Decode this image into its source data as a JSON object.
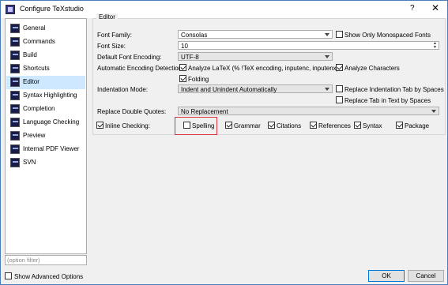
{
  "window": {
    "title": "Configure TeXstudio",
    "help": "?",
    "close": "✕"
  },
  "sidebar": {
    "items": [
      {
        "label": "General"
      },
      {
        "label": "Commands"
      },
      {
        "label": "Build"
      },
      {
        "label": "Shortcuts"
      },
      {
        "label": "Editor"
      },
      {
        "label": "Syntax Highlighting"
      },
      {
        "label": "Completion"
      },
      {
        "label": "Language Checking"
      },
      {
        "label": "Preview"
      },
      {
        "label": "Internal PDF Viewer"
      },
      {
        "label": "SVN"
      }
    ],
    "selected": "Editor",
    "filter_placeholder": "(option filter)"
  },
  "editor": {
    "group_title": "Editor",
    "font_family_label": "Font Family:",
    "font_family_value": "Consolas",
    "show_monospaced_label": "Show Only Monospaced Fonts",
    "font_size_label": "Font Size:",
    "font_size_value": "10",
    "default_encoding_label": "Default Font Encoding:",
    "default_encoding_value": "UTF-8",
    "auto_encoding_label": "Automatic Encoding Detection",
    "analyze_latex_label": "Analyze LaTeX (% !TeX encoding, inputenc, inputenx)",
    "analyze_characters_label": "Analyze Characters",
    "folding_label": "Folding",
    "indentation_mode_label": "Indentation Mode:",
    "indentation_mode_value": "Indent and Unindent Automatically",
    "replace_indent_tab_label": "Replace Indentation Tab by Spaces",
    "replace_tab_text_label": "Replace Tab in Text by Spaces",
    "replace_quotes_label": "Replace Double Quotes:",
    "replace_quotes_value": "No Replacement",
    "inline_checking_label": "Inline Checking:",
    "spelling_label": "Spelling",
    "grammar_label": "Grammar",
    "citations_label": "Citations",
    "references_label": "References",
    "syntax_label": "Syntax",
    "package_label": "Package"
  },
  "footer": {
    "show_advanced_label": "Show Advanced Options",
    "ok_label": "OK",
    "cancel_label": "Cancel"
  }
}
